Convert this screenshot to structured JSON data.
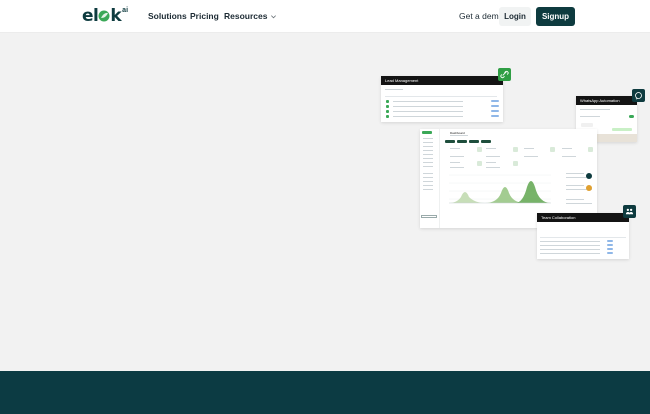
{
  "header": {
    "logo_text": "elk",
    "logo_suffix": "ai",
    "nav": {
      "solutions": "Solutions",
      "pricing": "Pricing",
      "resources": "Resources"
    },
    "get_demo": "Get a demo",
    "login": "Login",
    "signup": "Signup"
  },
  "illustration": {
    "lead_management_title": "Lead Management",
    "whatsapp_title": "WhatsApp Automation",
    "team_title": "Team Collaboration",
    "dashboard_title": "Dashboard"
  },
  "colors": {
    "brand_dark": "#0e3b3f",
    "brand_green": "#3aa857",
    "footer": "#0c3b43",
    "page_bg": "#f2f2f2"
  },
  "icons": {
    "leaf": "leaf-icon",
    "chevron": "chevron-down-icon",
    "link": "link-icon",
    "chat": "chat-icon",
    "users": "users-icon"
  }
}
